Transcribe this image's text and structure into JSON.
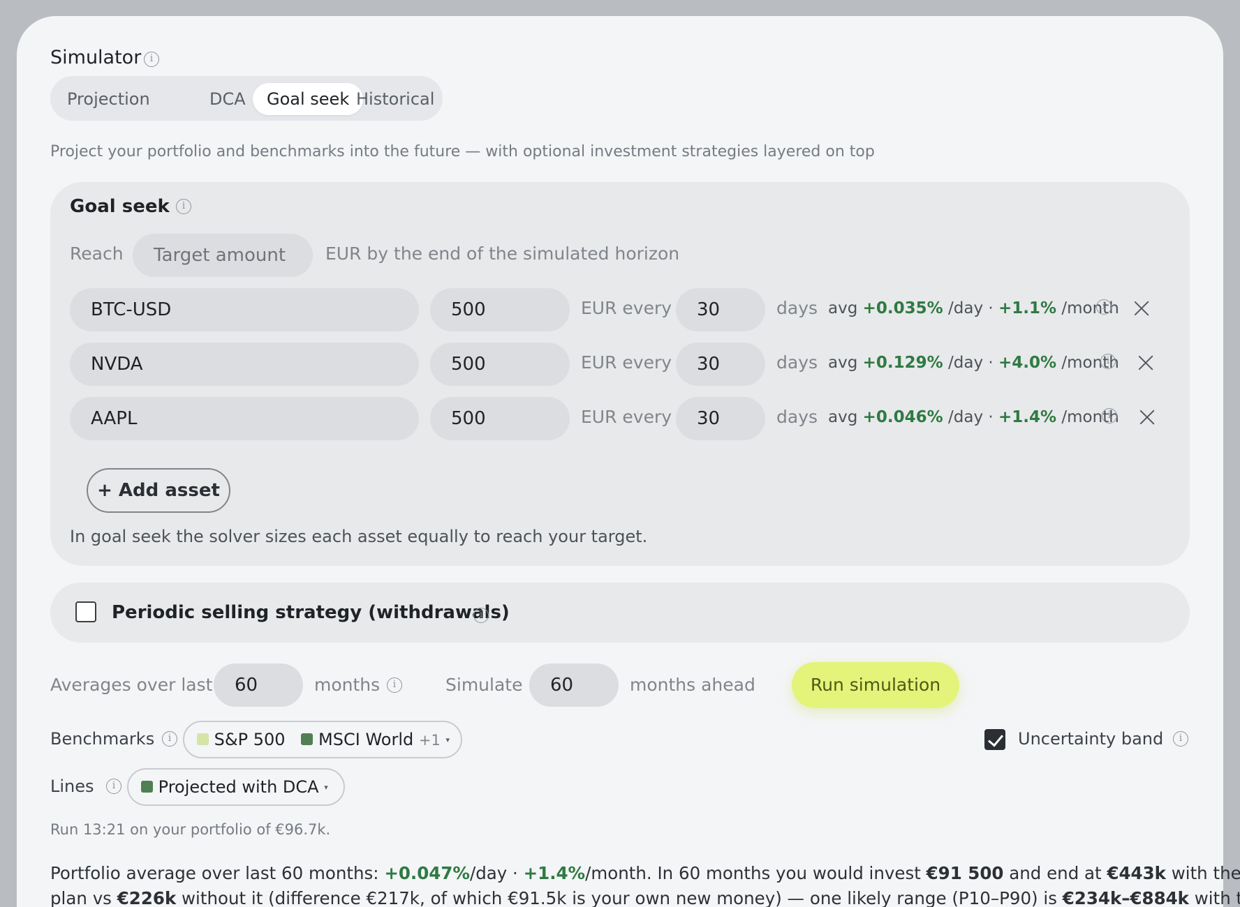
{
  "header": {
    "title": "Simulator"
  },
  "tabs": [
    {
      "label": "Projection",
      "active": false
    },
    {
      "label": "DCA",
      "active": false
    },
    {
      "label": "Goal seek",
      "active": true
    },
    {
      "label": "Historical",
      "active": false
    }
  ],
  "description": "Project your portfolio and benchmarks into the future — with optional investment strategies layered on top",
  "goal_seek": {
    "heading": "Goal seek",
    "reach_label": "Reach",
    "target_placeholder": "Target amount",
    "target_suffix": "EUR by the end of the simulated horizon",
    "assets": [
      {
        "ticker": "BTC-USD",
        "amount": "500",
        "every_label": "EUR every",
        "days": "30",
        "days_label": "days",
        "avg_label": "avg",
        "daily": "+0.035%",
        "day_unit": "/day ·",
        "monthly": "+1.1%",
        "month_unit": "/month"
      },
      {
        "ticker": "NVDA",
        "amount": "500",
        "every_label": "EUR every",
        "days": "30",
        "days_label": "days",
        "avg_label": "avg",
        "daily": "+0.129%",
        "day_unit": "/day ·",
        "monthly": "+4.0%",
        "month_unit": "/month"
      },
      {
        "ticker": "AAPL",
        "amount": "500",
        "every_label": "EUR every",
        "days": "30",
        "days_label": "days",
        "avg_label": "avg",
        "daily": "+0.046%",
        "day_unit": "/day ·",
        "monthly": "+1.4%",
        "month_unit": "/month"
      }
    ],
    "add_asset_label": "+ Add asset",
    "note": "In goal seek the solver sizes each asset equally to reach your target."
  },
  "withdrawals": {
    "label": "Periodic selling strategy (withdrawals)",
    "checked": false
  },
  "controls": {
    "averages_label": "Averages over last",
    "averages_value": "60",
    "averages_unit": "months",
    "simulate_label": "Simulate",
    "simulate_value": "60",
    "simulate_unit": "months ahead",
    "run_label": "Run simulation"
  },
  "benchmarks": {
    "label": "Benchmarks",
    "items": [
      {
        "name": "S&P 500",
        "color": "#d6e4a6"
      },
      {
        "name": "MSCI World",
        "color": "#4f7f52"
      }
    ],
    "more": "+1"
  },
  "uncertainty": {
    "label": "Uncertainty band",
    "checked": true
  },
  "lines": {
    "label": "Lines",
    "items": [
      {
        "name": "Projected with DCA",
        "color": "#4f7f52"
      }
    ]
  },
  "run_info": "Run 13:21 on your portfolio of €96.7k.",
  "summary": {
    "l1_a": "Portfolio average over last 60 months: ",
    "l1_daily": "+0.047%",
    "l1_b": "/day · ",
    "l1_monthly": "+1.4%",
    "l1_c": "/month. In 60 months you would invest ",
    "l1_invest": "€91 500",
    "l1_d": " and end at ",
    "l1_end": "€443k",
    "l1_e": " with the DCA",
    "l2_a": "plan vs ",
    "l2_without": "€226k",
    "l2_b": " without it (difference €217k, of which €91.5k is your own new money) — one likely range (P10–P90) is ",
    "l2_range": "€234k–€884k",
    "l2_c": " with the"
  },
  "colors": {
    "positive": "#2f7a43",
    "run_button": "#e4f47a",
    "background": "#f4f5f7"
  }
}
